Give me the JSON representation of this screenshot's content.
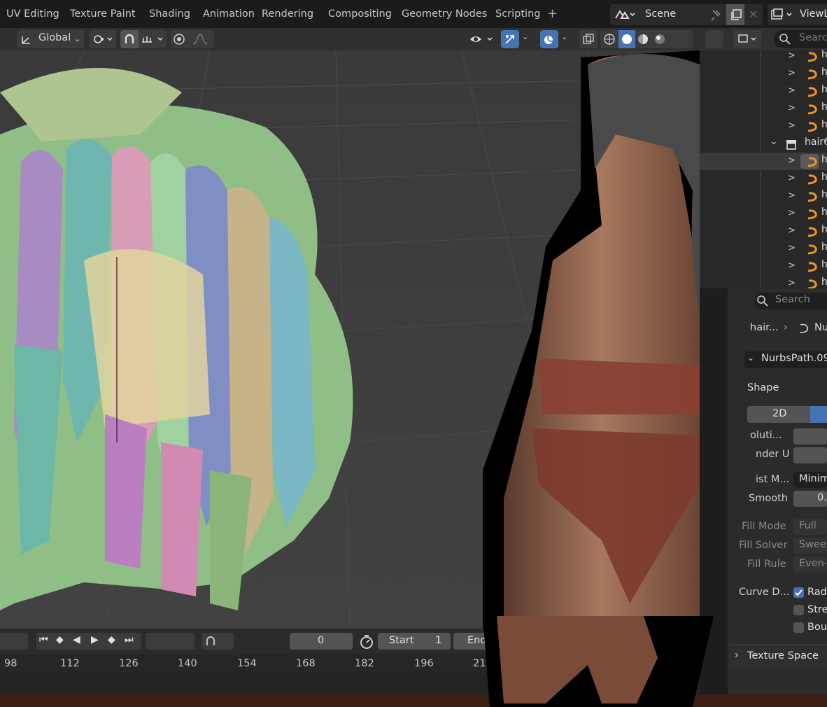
{
  "workspace_tabs": [
    "UV Editing",
    "Texture Paint",
    "Shading",
    "Animation",
    "Rendering",
    "Compositing",
    "Geometry Nodes",
    "Scripting"
  ],
  "add_workspace": "+",
  "scene": {
    "name": "Scene",
    "view_layer": "ViewL"
  },
  "viewport_header": {
    "transform_orientation": "Global"
  },
  "outliner": {
    "search_placeholder": "Searc",
    "collection_name": "hair6",
    "item_label": "h"
  },
  "properties": {
    "search_placeholder": "Search",
    "breadcrumb": "hair...",
    "breadcrumb_next": "Nu",
    "datablock_name": "NurbsPath.09",
    "panel_shape": "Shape",
    "dim_2d": "2D",
    "rows": [
      {
        "label": "oluti...",
        "value": ""
      },
      {
        "label": "nder U",
        "value": ""
      },
      {
        "label": "ist M...",
        "value": "Minimu"
      },
      {
        "label": "Smooth",
        "value": "0."
      },
      {
        "label": "Fill Mode",
        "value": "Full"
      },
      {
        "label": "Fill Solver",
        "value": "Sweep"
      },
      {
        "label": "Fill Rule",
        "value": "Even-"
      }
    ],
    "curve_deform_label": "Curve D...",
    "checkboxes": [
      {
        "label": "Radi",
        "checked": true
      },
      {
        "label": "Stre",
        "checked": false
      },
      {
        "label": "Boun",
        "checked": false
      }
    ],
    "texture_space": "Texture Space"
  },
  "timeline": {
    "current_frame": "0",
    "start_label": "Start",
    "start_value": "1",
    "end_label": "End",
    "ruler": [
      "98",
      "112",
      "126",
      "140",
      "154",
      "168",
      "182",
      "196",
      "21"
    ]
  },
  "colors": {
    "accent": "#4772b3",
    "viewport": "#3d3d3d",
    "header": "#303030"
  }
}
